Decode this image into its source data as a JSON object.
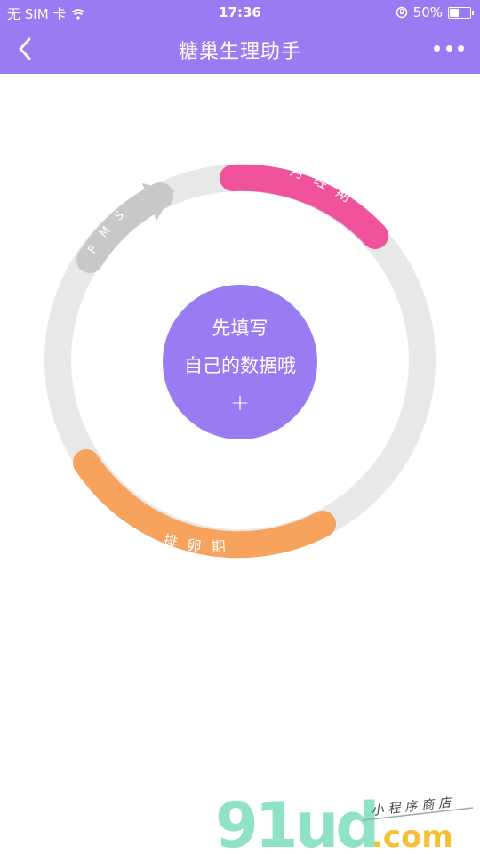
{
  "status_bar": {
    "carrier": "无 SIM 卡",
    "time": "17:36",
    "battery": "50%",
    "battery_level": 0.5
  },
  "navbar": {
    "title": "糖巢生理助手"
  },
  "cycle_ring": {
    "phases": [
      {
        "name": "月经期",
        "color": "#f0529b"
      },
      {
        "name": "排卵期",
        "color": "#f7a35e"
      },
      {
        "name": "PMS",
        "color": "#c8c8c8"
      }
    ],
    "track_color": "#e8e8e8"
  },
  "center_button": {
    "line1": "先填写",
    "line2": "自己的数据哦",
    "plus": "+"
  },
  "watermark": {
    "brand": "91ud",
    "domain": ".com",
    "tagline": "小程序商店"
  }
}
